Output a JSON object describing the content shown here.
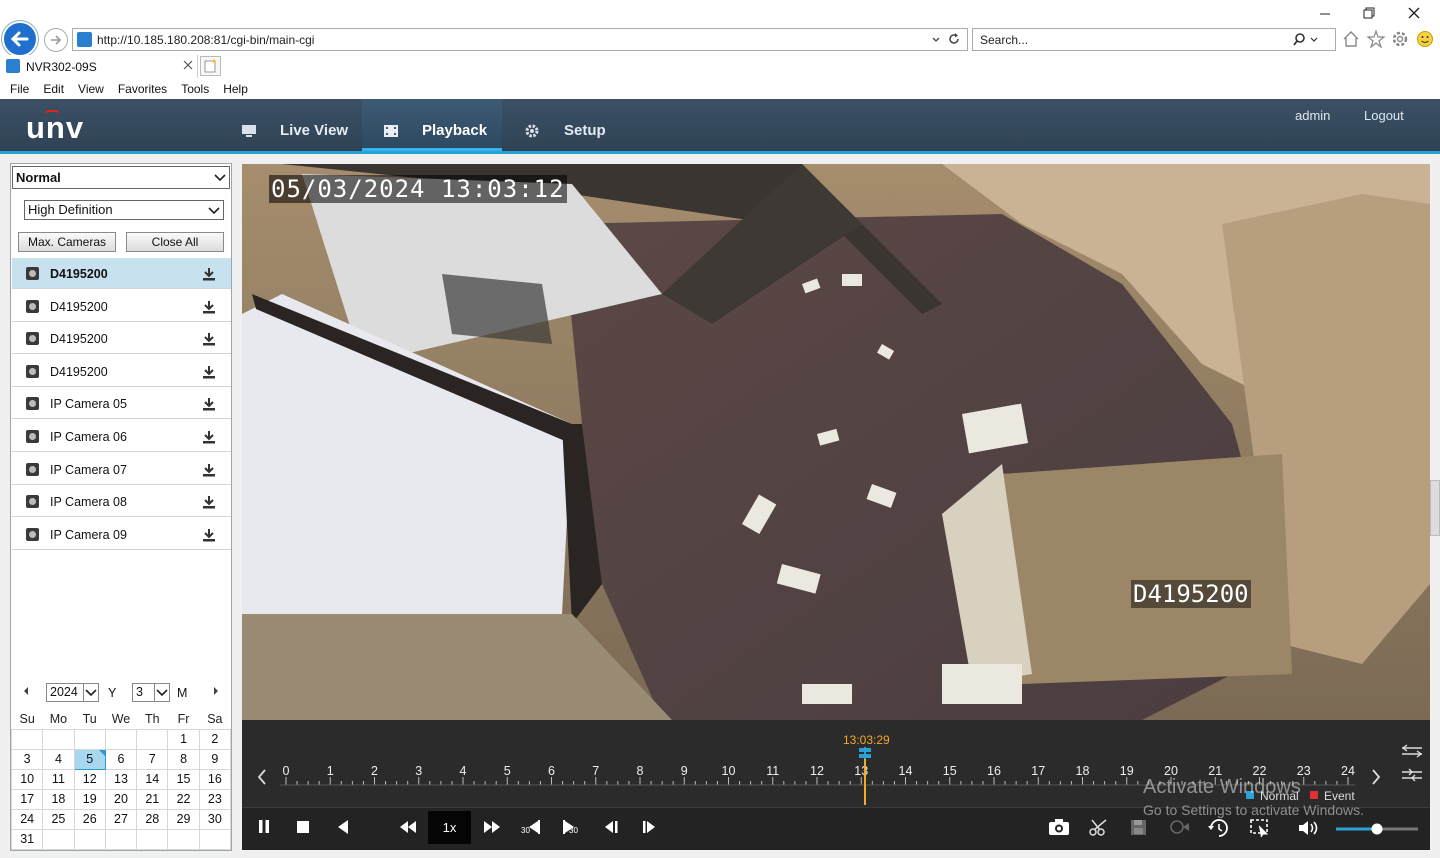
{
  "browser": {
    "url": "http://10.185.180.208:81/cgi-bin/main-cgi",
    "search_placeholder": "Search...",
    "tab_title": "NVR302-09S",
    "menu": [
      "File",
      "Edit",
      "View",
      "Favorites",
      "Tools",
      "Help"
    ]
  },
  "header": {
    "logo": "unv",
    "nav": [
      {
        "label": "Live View",
        "icon": "monitor-icon",
        "active": false
      },
      {
        "label": "Playback",
        "icon": "film-icon",
        "active": true
      },
      {
        "label": "Setup",
        "icon": "gear-icon",
        "active": false
      }
    ],
    "user": "admin",
    "logout": "Logout"
  },
  "sidebar": {
    "mode_select": "Normal",
    "quality_select": "High Definition",
    "max_cameras_label": "Max. Cameras",
    "close_all_label": "Close All",
    "cameras": [
      {
        "name": "D4195200",
        "selected": true
      },
      {
        "name": "D4195200",
        "selected": false
      },
      {
        "name": "D4195200",
        "selected": false
      },
      {
        "name": "D4195200",
        "selected": false
      },
      {
        "name": "IP Camera 05",
        "selected": false
      },
      {
        "name": "IP Camera 06",
        "selected": false
      },
      {
        "name": "IP Camera 07",
        "selected": false
      },
      {
        "name": "IP Camera 08",
        "selected": false
      },
      {
        "name": "IP Camera 09",
        "selected": false
      }
    ]
  },
  "calendar": {
    "year": "2024",
    "year_unit": "Y",
    "month": "3",
    "month_unit": "M",
    "weekdays": [
      "Su",
      "Mo",
      "Tu",
      "We",
      "Th",
      "Fr",
      "Sa"
    ],
    "weeks": [
      [
        "",
        "",
        "",
        "",
        "",
        "1",
        "2"
      ],
      [
        "3",
        "4",
        "5",
        "6",
        "7",
        "8",
        "9"
      ],
      [
        "10",
        "11",
        "12",
        "13",
        "14",
        "15",
        "16"
      ],
      [
        "17",
        "18",
        "19",
        "20",
        "21",
        "22",
        "23"
      ],
      [
        "24",
        "25",
        "26",
        "27",
        "28",
        "29",
        "30"
      ],
      [
        "31",
        "",
        "",
        "",
        "",
        "",
        ""
      ]
    ],
    "selected_day": "5"
  },
  "video": {
    "osd_time": "05/03/2024 13:03:12",
    "osd_camera": "D4195200"
  },
  "timeline": {
    "current_time": "13:03:29",
    "hours": [
      "0",
      "1",
      "2",
      "3",
      "4",
      "5",
      "6",
      "7",
      "8",
      "9",
      "10",
      "11",
      "12",
      "13",
      "14",
      "15",
      "16",
      "17",
      "18",
      "19",
      "20",
      "21",
      "22",
      "23",
      "24"
    ],
    "legend_normal": "Normal",
    "legend_event": "Event",
    "normal_color": "#2aa2d6",
    "event_color": "#e03030"
  },
  "controls": {
    "speed": "1x",
    "skip_back_label": "30",
    "skip_fwd_label": "30",
    "volume_fraction": 0.5
  },
  "watermark": {
    "line1": "Activate Windows",
    "line2": "Go to Settings to activate Windows."
  }
}
